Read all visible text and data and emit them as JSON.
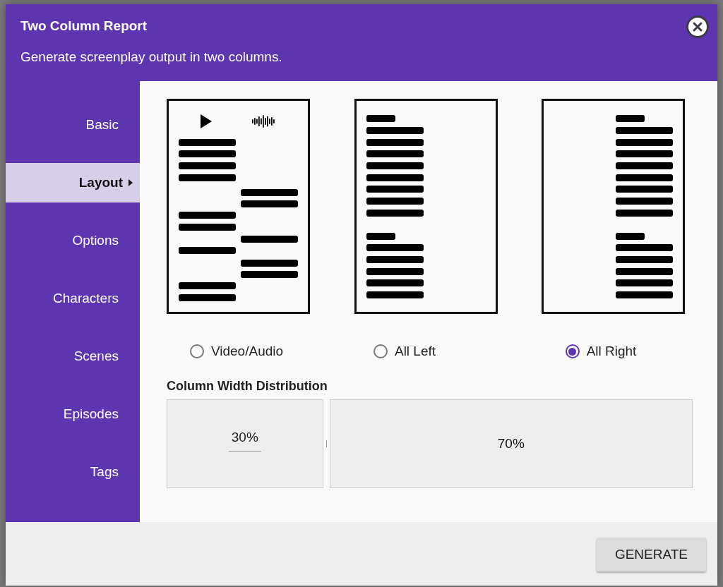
{
  "dialog": {
    "title": "Two Column Report",
    "subtitle": "Generate screenplay output in two columns."
  },
  "sidebar": {
    "items": [
      {
        "label": "Basic",
        "selected": false
      },
      {
        "label": "Layout",
        "selected": true
      },
      {
        "label": "Options",
        "selected": false
      },
      {
        "label": "Characters",
        "selected": false
      },
      {
        "label": "Scenes",
        "selected": false
      },
      {
        "label": "Episodes",
        "selected": false
      },
      {
        "label": "Tags",
        "selected": false
      }
    ]
  },
  "layouts": [
    {
      "kind": "video-audio",
      "label": "Video/Audio",
      "selected": false
    },
    {
      "kind": "left",
      "label": "All Left",
      "selected": false
    },
    {
      "kind": "right",
      "label": "All Right",
      "selected": true
    }
  ],
  "column_width": {
    "title": "Column Width Distribution",
    "left_value": "30%",
    "right_value": "70%"
  },
  "footer": {
    "button": "GENERATE"
  }
}
